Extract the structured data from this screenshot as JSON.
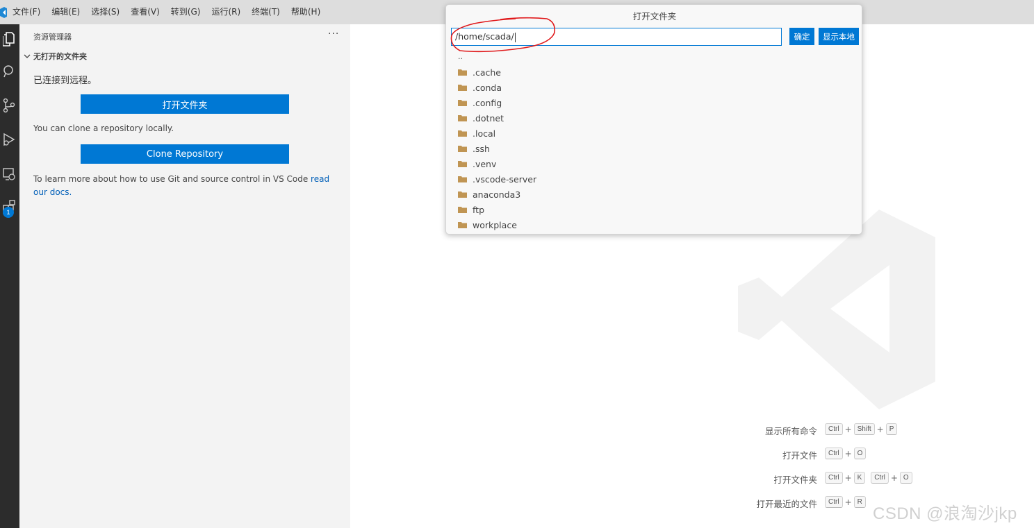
{
  "menubar": {
    "items": [
      "文件(F)",
      "编辑(E)",
      "选择(S)",
      "查看(V)",
      "转到(G)",
      "运行(R)",
      "终端(T)",
      "帮助(H)"
    ]
  },
  "activitybar": {
    "icons": [
      "explorer-icon",
      "search-icon",
      "source-control-icon",
      "run-debug-icon",
      "remote-explorer-icon",
      "extensions-icon"
    ],
    "extensions_badge": "1"
  },
  "sidebar": {
    "title": "资源管理器",
    "more": "···",
    "section": "无打开的文件夹",
    "connected": "已连接到远程。",
    "open_folder_button": "打开文件夹",
    "clone_text": "You can clone a repository locally.",
    "clone_button": "Clone Repository",
    "learn_text": "To learn more about how to use Git and source control in VS Code ",
    "learn_link": "read our docs."
  },
  "dialog": {
    "title": "打开文件夹",
    "path_value": "/home/scada/",
    "ok_button": "确定",
    "show_local_button": "显示本地",
    "parent_dir": "..",
    "folders": [
      ".cache",
      ".conda",
      ".config",
      ".dotnet",
      ".local",
      ".ssh",
      ".venv",
      ".vscode-server",
      "anaconda3",
      "ftp",
      "workplace"
    ]
  },
  "shortcuts": [
    {
      "label": "显示所有命令",
      "keys": [
        [
          "Ctrl",
          "Shift",
          "P"
        ]
      ]
    },
    {
      "label": "打开文件",
      "keys": [
        [
          "Ctrl",
          "O"
        ]
      ]
    },
    {
      "label": "打开文件夹",
      "keys": [
        [
          "Ctrl",
          "K"
        ],
        [
          "Ctrl",
          "O"
        ]
      ]
    },
    {
      "label": "打开最近的文件",
      "keys": [
        [
          "Ctrl",
          "R"
        ]
      ]
    }
  ],
  "watermark": "CSDN @浪淘沙jkp",
  "colors": {
    "accent": "#0078d4",
    "annotation": "#e0191b",
    "folder": "#c09553"
  }
}
